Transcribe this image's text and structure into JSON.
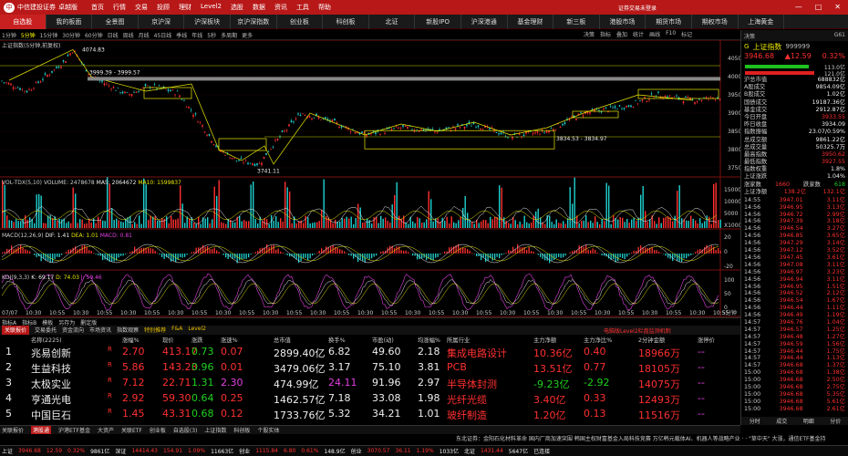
{
  "brand": {
    "name": "中信建投证券",
    "sub": "CHINA SECURITIES",
    "product": "卓越版"
  },
  "menu": [
    "首页",
    "行情",
    "交易",
    "投顾",
    "理财",
    "Level2",
    "选股",
    "数据",
    "资讯",
    "工具",
    "帮助"
  ],
  "login_text": "证券交易未登录",
  "window_buttons": [
    "—",
    "□",
    "✕"
  ],
  "nav_tabs": [
    "自选股",
    "我的板面",
    "全景图",
    "京沪深",
    "沪深板块",
    "京沪深指数",
    "创业板",
    "科创板",
    "北证",
    "新股IPO",
    "沪深港通",
    "基金理财",
    "新三板",
    "港股市场",
    "期货市场",
    "期权市场",
    "上海黄金"
  ],
  "chart_toolbar": {
    "items": [
      "1分钟",
      "5分钟",
      "15分钟",
      "30分钟",
      "60分钟",
      "日线",
      "周线",
      "月线",
      "45日线",
      "季线",
      "年线",
      "5秒",
      "多周期",
      "更多"
    ],
    "selected": "5分钟",
    "right": [
      "决策",
      "指标",
      "叠加",
      "统计",
      "画线",
      "F10",
      "标记"
    ]
  },
  "chart_title": "上证指数(5分钟,前复权)",
  "price_axis": [
    "4050",
    "4000",
    "3950",
    "3900",
    "3850",
    "3800",
    "3750"
  ],
  "annotations": {
    "high": "4074.83",
    "box1": "3999.39 - 3999.57",
    "low": "3741.11",
    "box2": "3834.53 - 3834.97"
  },
  "vol": {
    "label": "VOL-TDX(5,10)",
    "volume": "VOLUME: 2478678",
    "ma5": "MA5: 2064672",
    "ma10": "MA10: 1599837",
    "axis": [
      "15000",
      "10000",
      "5000",
      "X1000"
    ]
  },
  "macd": {
    "label": "MACD(12,26,9)",
    "dif": "DIF: 1.41",
    "dea": "DEA: 1.01",
    "macd": "MACD: 0.81",
    "axis": [
      "20",
      "0",
      "-20"
    ]
  },
  "kdj": {
    "label": "KDJ(9,3,3)",
    "k": "K: 69.17",
    "d": "D: 74.03",
    "j": "J: 59.46",
    "axis": [
      "100",
      "50",
      "0"
    ]
  },
  "time_axis": [
    "07/07",
    "10:30",
    "10:55",
    "10:30",
    "10:55",
    "10:30",
    "10:55",
    "10:30",
    "10:55",
    "10:30",
    "10:55",
    "10:30",
    "10:55",
    "10:30",
    "10:55",
    "10:30",
    "10:55",
    "10:30",
    "10:55",
    "10:30",
    "10:55",
    "10:30",
    "10:55",
    "10:30",
    "10:55",
    "10:30",
    "10:55",
    "10:30",
    "10:55",
    "10:30",
    "10:55"
  ],
  "period_label": "5分钟",
  "bottom_tabs": [
    "指标A",
    "指标B",
    "模板",
    "另存为",
    "删定版"
  ],
  "sub_tabs": [
    "关联报价",
    "交易委托",
    "资金流向",
    "市场资讯",
    "指数观察",
    "特别推荐",
    "F&A",
    "Level2"
  ],
  "right_note": "电脑版Level2栏盘监测机制",
  "table": {
    "headers": [
      "",
      "名称(2225)",
      "",
      "涨幅%",
      "现价",
      "涨跌",
      "涨速%",
      "总市值",
      "换手%",
      "市盈(动)",
      "均涨幅%",
      "所属行业",
      "主力净额",
      "主力净比%",
      "2分钟金额",
      "涨停价"
    ],
    "rows": [
      [
        "1",
        "兆易创新",
        "R",
        "2.70",
        "413.17",
        "0.73",
        "0.07",
        "2899.40亿",
        "6.82",
        "49.60",
        "2.18",
        "集成电路设计",
        "10.36亿",
        "0.40",
        "18966万",
        "--"
      ],
      [
        "2",
        "生益科技",
        "R",
        "5.86",
        "143.23",
        "0.96",
        "0.01",
        "3479.06亿",
        "3.17",
        "75.10",
        "3.81",
        "PCB",
        "13.51亿",
        "0.77",
        "18105万",
        "--"
      ],
      [
        "3",
        "太极实业",
        "R",
        "7.12",
        "22.71",
        "1.31",
        "2.30",
        "474.99亿",
        "24.11",
        "91.96",
        "2.97",
        "半导体封测",
        "-9.23亿",
        "-2.92",
        "14075万",
        "--"
      ],
      [
        "4",
        "亨通光电",
        "R",
        "2.92",
        "59.30",
        "0.64",
        "0.25",
        "1462.57亿",
        "7.18",
        "33.08",
        "1.98",
        "光纤光缆",
        "3.40亿",
        "0.33",
        "12493万",
        "--"
      ],
      [
        "5",
        "中国巨石",
        "R",
        "1.45",
        "43.31",
        "0.68",
        "0.12",
        "1733.76亿",
        "5.32",
        "34.21",
        "1.01",
        "玻纤制造",
        "1.20亿",
        "0.13",
        "11516万",
        "--"
      ]
    ]
  },
  "section_tabs": [
    "关联报价",
    "港股通",
    "沪港ETF基金",
    "大资产",
    "关联ETF",
    "创业板",
    "自选股(3)",
    "上证指数",
    "科创板",
    "个股实体"
  ],
  "ticker": "东北证券：金阳石化材料革命  国内厂商加速突围   韩国主权财富基金入局科技竞赛 万亿韩元载体AI、机器人等战略产业 · · \"草中天\" 大涨，通信ETF基金持",
  "status": [
    "上证",
    "3946.68",
    "12.59",
    "0.32%",
    "9861亿",
    "深证",
    "14414.43",
    "154.91",
    "1.09%",
    "11663亿",
    "创业",
    "1115.84",
    "6.80",
    "0.61%",
    "148.9亿",
    "创业",
    "3070.57",
    "36.11",
    "1.19%",
    "1033亿",
    "北证",
    "1431.44",
    "5647亿",
    "已连接"
  ],
  "rp": {
    "head": {
      "left": "决策",
      "right": "G61"
    },
    "code": "999999",
    "name": "上证指数",
    "g": "G",
    "price": "3946.68",
    "chg": "▲12.59",
    "pct": "0.32%",
    "bar_vals": [
      "113.0亿",
      "121.0亿"
    ],
    "stats": [
      [
        "沪总市值",
        "688832亿"
      ],
      [
        "A股成交",
        "9854.09亿"
      ],
      [
        "B股成交",
        "1.02亿"
      ],
      [
        "国债成交",
        "19187.36亿"
      ],
      [
        "基金成交",
        "2912.87亿"
      ],
      [
        "今日开盘",
        "3933.55"
      ],
      [
        "昨日收盘",
        "3934.09"
      ],
      [
        "指数振幅",
        "23.07/0.59%"
      ],
      [
        "总成交额",
        "9861.22亿"
      ],
      [
        "总成交量",
        "50325.7万"
      ],
      [
        "最高指数",
        "3950.62"
      ],
      [
        "最低指数",
        "3927.55"
      ],
      [
        "指数权重",
        "1.8%"
      ],
      [
        "上证涨跌",
        "1.04%"
      ]
    ],
    "counts": {
      "up_label": "涨家数",
      "up": "1660",
      "down_label": "跌家数",
      "down": "618"
    },
    "net_label": "上证净额",
    "net_vals": [
      "138.2亿",
      "132.1亿"
    ],
    "ticks": [
      [
        "14:55",
        "3947.01",
        "3.11亿"
      ],
      [
        "14:56",
        "3946.95",
        "3.13亿"
      ],
      [
        "14:56",
        "3946.72",
        "2.99亿"
      ],
      [
        "14:56",
        "3947.39",
        "3.18亿"
      ],
      [
        "14:56",
        "3946.54",
        "3.27亿"
      ],
      [
        "14:56",
        "3946.85",
        "3.65亿"
      ],
      [
        "14:56",
        "3947.29",
        "3.14亿"
      ],
      [
        "14:56",
        "3947.12",
        "3.52亿"
      ],
      [
        "14:56",
        "3947.45",
        "3.61亿"
      ],
      [
        "14:56",
        "3947.08",
        "3.11亿"
      ],
      [
        "14:56",
        "3946.97",
        "3.23亿"
      ],
      [
        "14:56",
        "3946.94",
        "3.11亿"
      ],
      [
        "14:56",
        "3946.95",
        "1.51亿"
      ],
      [
        "14:56",
        "3946.52",
        "2.12亿"
      ],
      [
        "14:56",
        "3946.54",
        "1.67亿"
      ],
      [
        "14:56",
        "3946.44",
        "1.11亿"
      ],
      [
        "14:56",
        "3946.49",
        "1.19亿"
      ],
      [
        "14:57",
        "3946.76",
        "1.04亿"
      ],
      [
        "14:57",
        "3946.57",
        "1.25亿"
      ],
      [
        "14:57",
        "3946.48",
        "1.27亿"
      ],
      [
        "14:57",
        "3946.59",
        "1.56亿"
      ],
      [
        "14:57",
        "3946.44",
        "1.75亿"
      ],
      [
        "14:57",
        "3946.44",
        "1.13亿"
      ],
      [
        "14:57",
        "3946.68",
        "1.37亿"
      ],
      [
        "15:00",
        "3946.68",
        "1.38亿"
      ],
      [
        "15:00",
        "3946.68",
        "2.50亿"
      ],
      [
        "15:00",
        "3946.68",
        "2.75亿"
      ],
      [
        "15:00",
        "3946.68",
        "5.35亿"
      ],
      [
        "15:00",
        "3946.68",
        "5.61亿"
      ],
      [
        "15:00",
        "3946.68",
        "2.61亿"
      ]
    ],
    "bottom_tabs": [
      "分时",
      "成交",
      "明细",
      "分价"
    ]
  }
}
